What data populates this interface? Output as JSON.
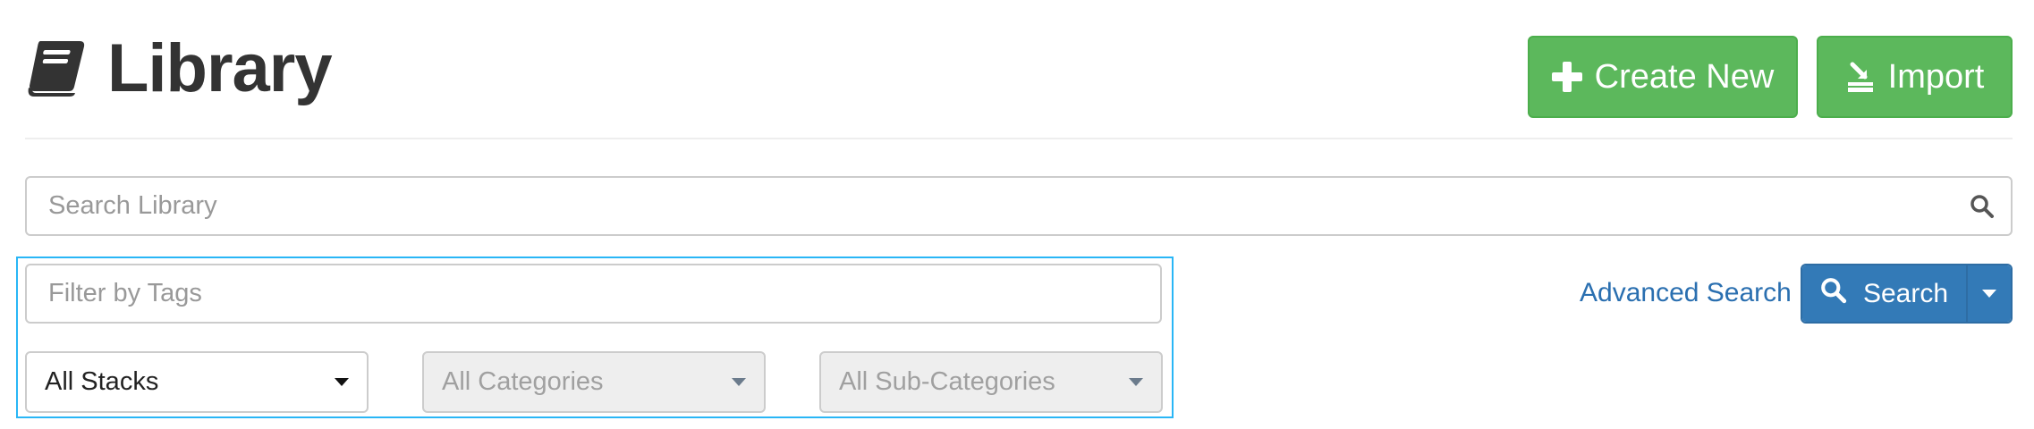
{
  "header": {
    "title": "Library",
    "title_icon": "book-icon",
    "create_label": "Create New",
    "create_icon": "plus-icon",
    "import_label": "Import",
    "import_icon": "import-icon"
  },
  "search": {
    "placeholder": "Search Library",
    "value": "",
    "icon": "search-icon"
  },
  "filters": {
    "tags_placeholder": "Filter by Tags",
    "tags_value": "",
    "stacks": {
      "selected": "All Stacks",
      "enabled": true
    },
    "categories": {
      "selected": "All Categories",
      "enabled": false
    },
    "subcategories": {
      "selected": "All Sub-Categories",
      "enabled": false
    }
  },
  "actions": {
    "advanced_search_label": "Advanced Search",
    "search_label": "Search",
    "search_icon": "search-icon",
    "dropdown_icon": "caret-down-icon"
  },
  "colors": {
    "success": "#5cb85c",
    "primary": "#337ab7",
    "link": "#2a6fb0",
    "highlight_border": "#29b6f6",
    "disabled_bg": "#eeeeee"
  }
}
